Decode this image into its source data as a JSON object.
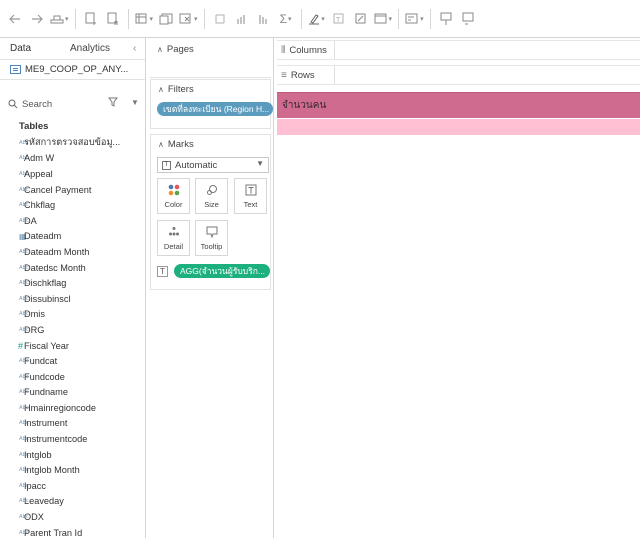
{
  "toolbar": {
    "buttons": [
      "back-icon",
      "forward-icon",
      "save-icon",
      "new-data-source-icon",
      "pause-updates-icon",
      "new-worksheet-icon",
      "duplicate-icon",
      "clear-icon",
      "swap-icon",
      "sort-ascending-icon",
      "sort-descending-icon",
      "totals-icon",
      "highlight-icon",
      "group-icon",
      "label-icon",
      "fit-icon",
      "show-me-icon",
      "tooltip-icon",
      "presentation-icon"
    ]
  },
  "data_pane": {
    "tabs": {
      "data": "Data",
      "analytics": "Analytics"
    },
    "collapse": "‹",
    "datasource": "ME9_COOP_OP_ANY...",
    "search_placeholder": "Search",
    "section": "Tables",
    "fields": [
      {
        "type": "Abc",
        "name": "รหัสการตรวจสอบข้อมู..."
      },
      {
        "type": "Abc",
        "name": "Adm W"
      },
      {
        "type": "Abc",
        "name": "Appeal"
      },
      {
        "type": "Abc",
        "name": "Cancel Payment"
      },
      {
        "type": "Abc",
        "name": "Chkflag"
      },
      {
        "type": "Abc",
        "name": "DA"
      },
      {
        "type": "date",
        "name": "Dateadm"
      },
      {
        "type": "Abc",
        "name": "Dateadm Month"
      },
      {
        "type": "Abc",
        "name": "Datedsc Month"
      },
      {
        "type": "Abc",
        "name": "Dischkflag"
      },
      {
        "type": "Abc",
        "name": "Dissubinscl"
      },
      {
        "type": "Abc",
        "name": "Dmis"
      },
      {
        "type": "Abc",
        "name": "DRG"
      },
      {
        "type": "num",
        "name": "Fiscal Year"
      },
      {
        "type": "Abc",
        "name": "Fundcat"
      },
      {
        "type": "Abc",
        "name": "Fundcode"
      },
      {
        "type": "Abc",
        "name": "Fundname"
      },
      {
        "type": "Abc",
        "name": "Hmainregioncode"
      },
      {
        "type": "Abc",
        "name": "Instrument"
      },
      {
        "type": "Abc",
        "name": "Instrumentcode"
      },
      {
        "type": "Abc",
        "name": "Intglob"
      },
      {
        "type": "Abc",
        "name": "Intglob Month"
      },
      {
        "type": "Abc",
        "name": "Ipacc"
      },
      {
        "type": "Abc",
        "name": "Leaveday"
      },
      {
        "type": "Abc",
        "name": "ODX"
      },
      {
        "type": "Abc",
        "name": "Parent Tran Id"
      }
    ]
  },
  "pages": {
    "title": "Pages"
  },
  "filters": {
    "title": "Filters",
    "pill": "เขตที่ลงทะเบียน (Region H..."
  },
  "marks": {
    "title": "Marks",
    "type": "Automatic",
    "buttons": {
      "color": "Color",
      "size": "Size",
      "text": "Text",
      "detail": "Detail",
      "tooltip": "Tooltip"
    },
    "pill": "AGG(จำนวนผู้รับบริก..."
  },
  "shelves": {
    "columns": "Columns",
    "rows": "Rows"
  },
  "viz": {
    "header": "จำนวนคน",
    "header_color": "#cf6b8f",
    "row_color": "#ffc0d4"
  }
}
